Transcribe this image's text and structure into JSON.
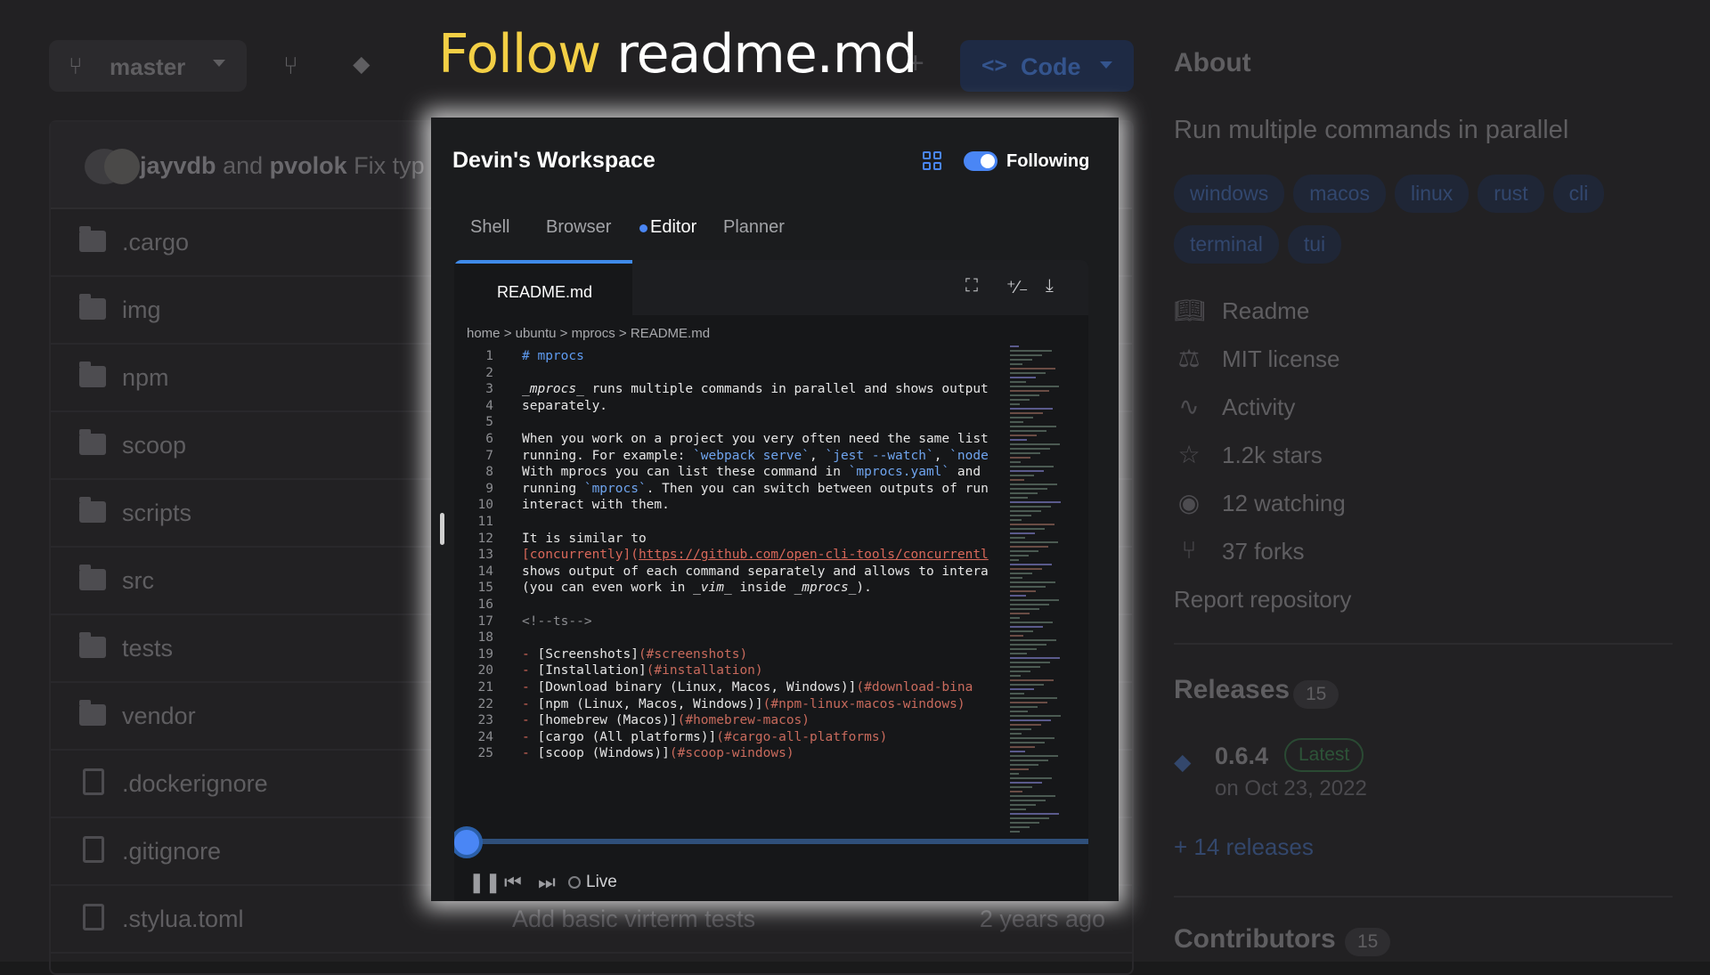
{
  "repo": {
    "branch": "master",
    "code_button": "Code",
    "commit": {
      "author1": "jayvdb",
      "joiner": "and",
      "author2": "pvolok",
      "message": "Fix typ"
    },
    "files": [
      {
        "name": ".cargo",
        "type": "folder",
        "message": "",
        "date": ""
      },
      {
        "name": "img",
        "type": "folder",
        "message": "",
        "date": ""
      },
      {
        "name": "npm",
        "type": "folder",
        "message": "",
        "date": ""
      },
      {
        "name": "scoop",
        "type": "folder",
        "message": "",
        "date": ""
      },
      {
        "name": "scripts",
        "type": "folder",
        "message": "",
        "date": ""
      },
      {
        "name": "src",
        "type": "folder",
        "message": "",
        "date": ""
      },
      {
        "name": "tests",
        "type": "folder",
        "message": "",
        "date": ""
      },
      {
        "name": "vendor",
        "type": "folder",
        "message": "",
        "date": ""
      },
      {
        "name": ".dockerignore",
        "type": "file",
        "message": "",
        "date": ""
      },
      {
        "name": ".gitignore",
        "type": "file",
        "message": "",
        "date": ""
      },
      {
        "name": ".stylua.toml",
        "type": "file",
        "message": "Add basic virterm tests",
        "date": "2 years ago"
      }
    ]
  },
  "about": {
    "title": "About",
    "description": "Run multiple commands in parallel",
    "topics": [
      "windows",
      "macos",
      "linux",
      "rust",
      "cli",
      "terminal",
      "tui"
    ],
    "readme": "Readme",
    "license": "MIT license",
    "activity": "Activity",
    "stars": "1.2k stars",
    "watching": "12 watching",
    "forks": "37 forks",
    "report": "Report repository"
  },
  "releases": {
    "title": "Releases",
    "count": "15",
    "version": "0.6.4",
    "latest_badge": "Latest",
    "date": "on Oct 23, 2022",
    "more": "+ 14 releases"
  },
  "contributors": {
    "title": "Contributors",
    "count": "15"
  },
  "headline": {
    "highlight": "Follow",
    "rest": "readme.md"
  },
  "workspace": {
    "title": "Devin's Workspace",
    "following": "Following",
    "tabs": [
      "Shell",
      "Browser",
      "Editor",
      "Planner"
    ],
    "active_tab": "Editor",
    "file_tab": "README.md",
    "breadcrumb": "home > ubuntu > mprocs > README.md",
    "live": "Live"
  },
  "colors": {
    "accent": "#4a86f5",
    "highlight": "#f3cf45"
  }
}
